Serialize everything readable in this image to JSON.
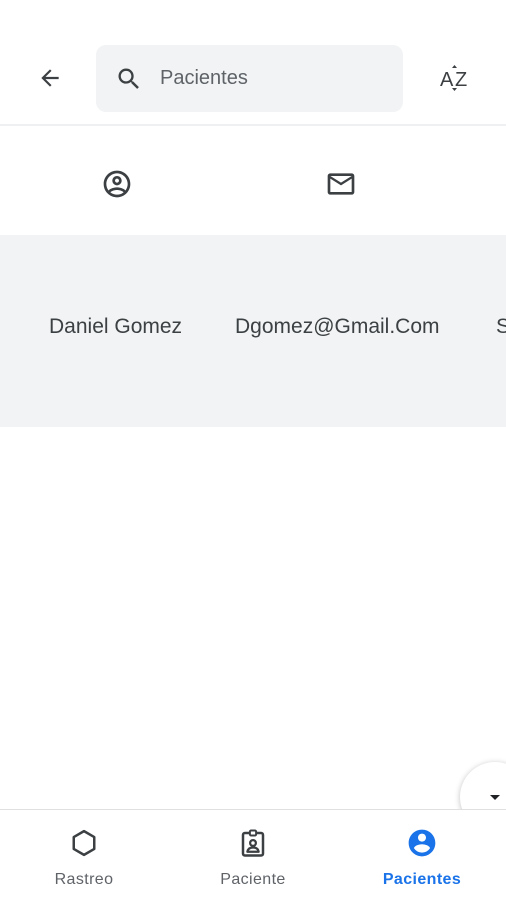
{
  "search": {
    "placeholder": "Pacientes"
  },
  "table": {
    "rows": [
      {
        "name": "Daniel Gomez",
        "email": "Dgomez@Gmail.Com",
        "extra": "S"
      }
    ]
  },
  "bottom_nav": {
    "items": [
      {
        "label": "Rastreo",
        "icon": "hexagon-icon"
      },
      {
        "label": "Paciente",
        "icon": "badge-icon"
      },
      {
        "label": "Pacientes",
        "icon": "account-circle-icon",
        "active": true
      }
    ]
  },
  "colors": {
    "accent": "#1a73e8",
    "row_background": "#f1f3f4",
    "text": "#3c4043"
  }
}
